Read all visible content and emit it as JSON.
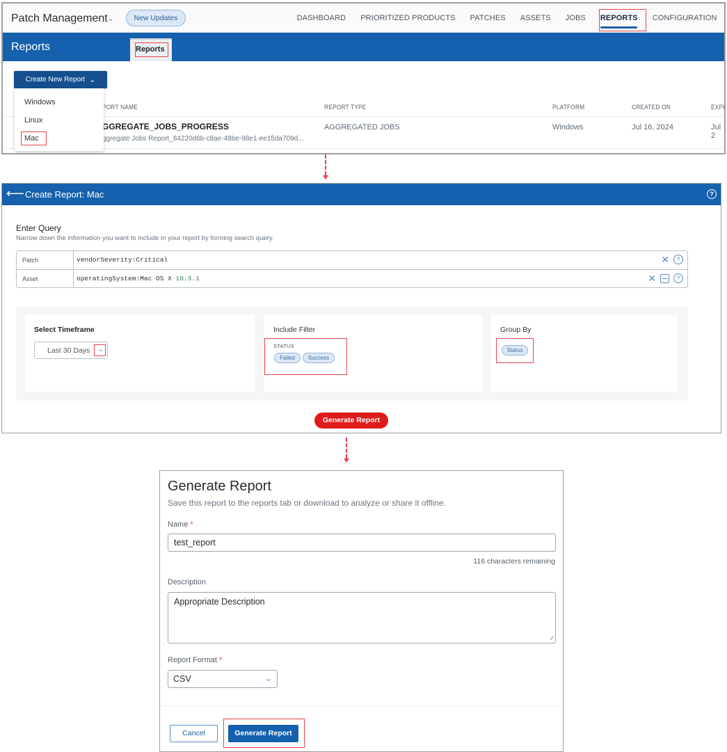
{
  "panel1": {
    "app_title": "Patch Management",
    "new_updates_label": "New Updates",
    "nav": [
      "DASHBOARD",
      "PRIORITIZED PRODUCTS",
      "PATCHES",
      "ASSETS",
      "JOBS",
      "REPORTS",
      "CONFIGURATION"
    ],
    "active_nav": "REPORTS",
    "section_title": "Reports",
    "subtab_label": "Reports",
    "create_button_label": "Create New Report",
    "dropdown_options": [
      "Windows",
      "Linux",
      "Mac"
    ],
    "selected_option": "Mac",
    "table": {
      "columns": [
        "REPORT NAME",
        "REPORT TYPE",
        "PLATFORM",
        "CREATED ON",
        "EXPIRES"
      ],
      "visible_columns": [
        "PORT NAME",
        "REPORT TYPE",
        "PLATFORM",
        "CREATED ON",
        "EXPIR"
      ],
      "rows": [
        {
          "name": "AGGREGATE_JOBS_PROGRESS",
          "name_visible": "GGREGATE_JOBS_PROGRESS",
          "subtitle_visible": "ggregate Jobs Report_84220d6b-c8ae-48be-98e1-ee15da709d...",
          "type": "AGGREGATED JOBS",
          "platform": "Windows",
          "created_on": "Jul 16, 2024",
          "expires_visible": "Jul 2"
        }
      ]
    }
  },
  "panel2": {
    "title": "Create Report: Mac",
    "enter_query_title": "Enter Query",
    "enter_query_subtitle": "Narrow down the information you want to include in your report by forming search query.",
    "queries": [
      {
        "label": "Patch",
        "value": "vendorSeverity:Critical",
        "value_num": ""
      },
      {
        "label": "Asset",
        "value": "operatingSystem:Mac OS X ",
        "value_num": "10.3.1"
      }
    ],
    "timeframe_title": "Select Timeframe",
    "timeframe_value": "Last 30 Days",
    "include_filter_title": "Include Filter",
    "include_filter_group": "STATUS",
    "include_filter_chips": [
      "Failed",
      "Success"
    ],
    "group_by_title": "Group By",
    "group_by_chips": [
      "Status"
    ],
    "generate_button_label": "Generate Report"
  },
  "panel3": {
    "title": "Generate Report",
    "subtitle": "Save this report to the reports tab or download to analyze or share it offline.",
    "name_label": "Name",
    "required_mark": "*",
    "name_value": "test_report",
    "chars_remaining": "116 characters remaining",
    "description_label": "Description",
    "description_value": "Appropriate Description",
    "format_label": "Report Format",
    "format_value": "CSV",
    "cancel_label": "Cancel",
    "generate_label": "Generate Report"
  },
  "colors": {
    "brand_blue": "#1561ad",
    "highlight_red": "#e8434a",
    "generate_red": "#e01b1b"
  }
}
